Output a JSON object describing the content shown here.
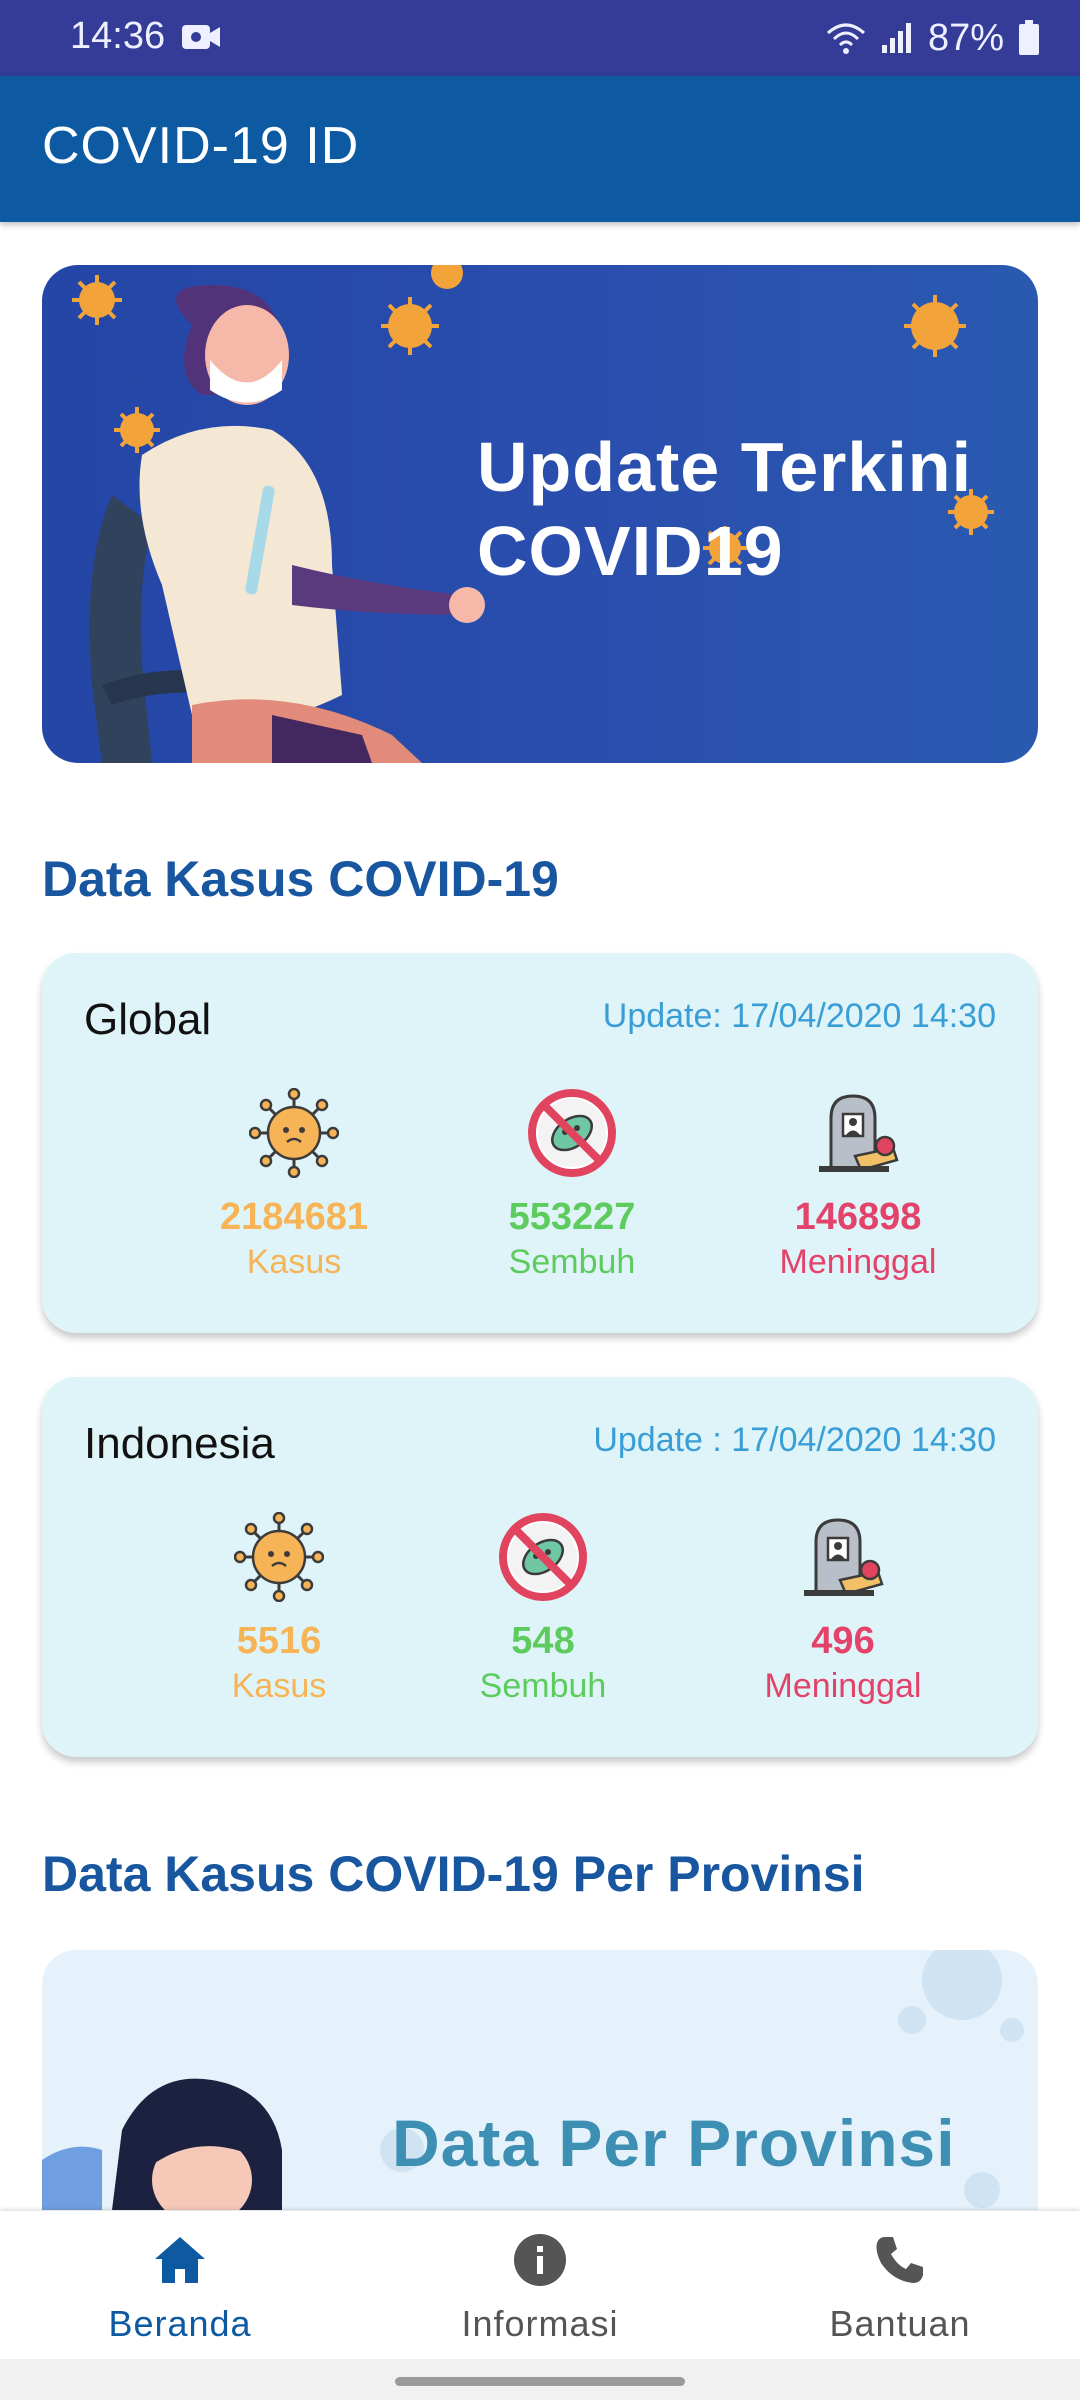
{
  "status_bar": {
    "time": "14:36",
    "battery": "87%",
    "icons": [
      "video-camera-icon",
      "wifi-icon",
      "signal-icon",
      "battery-icon"
    ]
  },
  "app_bar": {
    "title": "COVID-19 ID"
  },
  "banner": {
    "line1": "Update Terkini",
    "line2": "COVID19"
  },
  "section_cases": {
    "title": "Data Kasus COVID-19"
  },
  "global": {
    "title": "Global",
    "update": "Update: 17/04/2020 14:30",
    "kasus": {
      "value": "2184681",
      "label": "Kasus"
    },
    "sembuh": {
      "value": "553227",
      "label": "Sembuh"
    },
    "meninggal": {
      "value": "146898",
      "label": "Meninggal"
    }
  },
  "indonesia": {
    "title": "Indonesia",
    "update": "Update : 17/04/2020 14:30",
    "kasus": {
      "value": "5516",
      "label": "Kasus"
    },
    "sembuh": {
      "value": "548",
      "label": "Sembuh"
    },
    "meninggal": {
      "value": "496",
      "label": "Meninggal"
    }
  },
  "section_province": {
    "title": "Data Kasus COVID-19 Per Provinsi"
  },
  "province_banner": {
    "text": "Data Per Provinsi"
  },
  "bottom_nav": {
    "items": [
      {
        "label": "Beranda",
        "icon": "home-icon",
        "active": true
      },
      {
        "label": "Informasi",
        "icon": "info-icon",
        "active": false
      },
      {
        "label": "Bantuan",
        "icon": "phone-icon",
        "active": false
      }
    ]
  },
  "colors": {
    "status_bar": "#343c98",
    "app_bar": "#0d5aa3",
    "section_title": "#1856a0",
    "card_bg": "#dff4f8",
    "kasus": "#f6b457",
    "sembuh": "#5ecb5e",
    "meninggal": "#e3436a",
    "update_text": "#3a9ed6"
  }
}
